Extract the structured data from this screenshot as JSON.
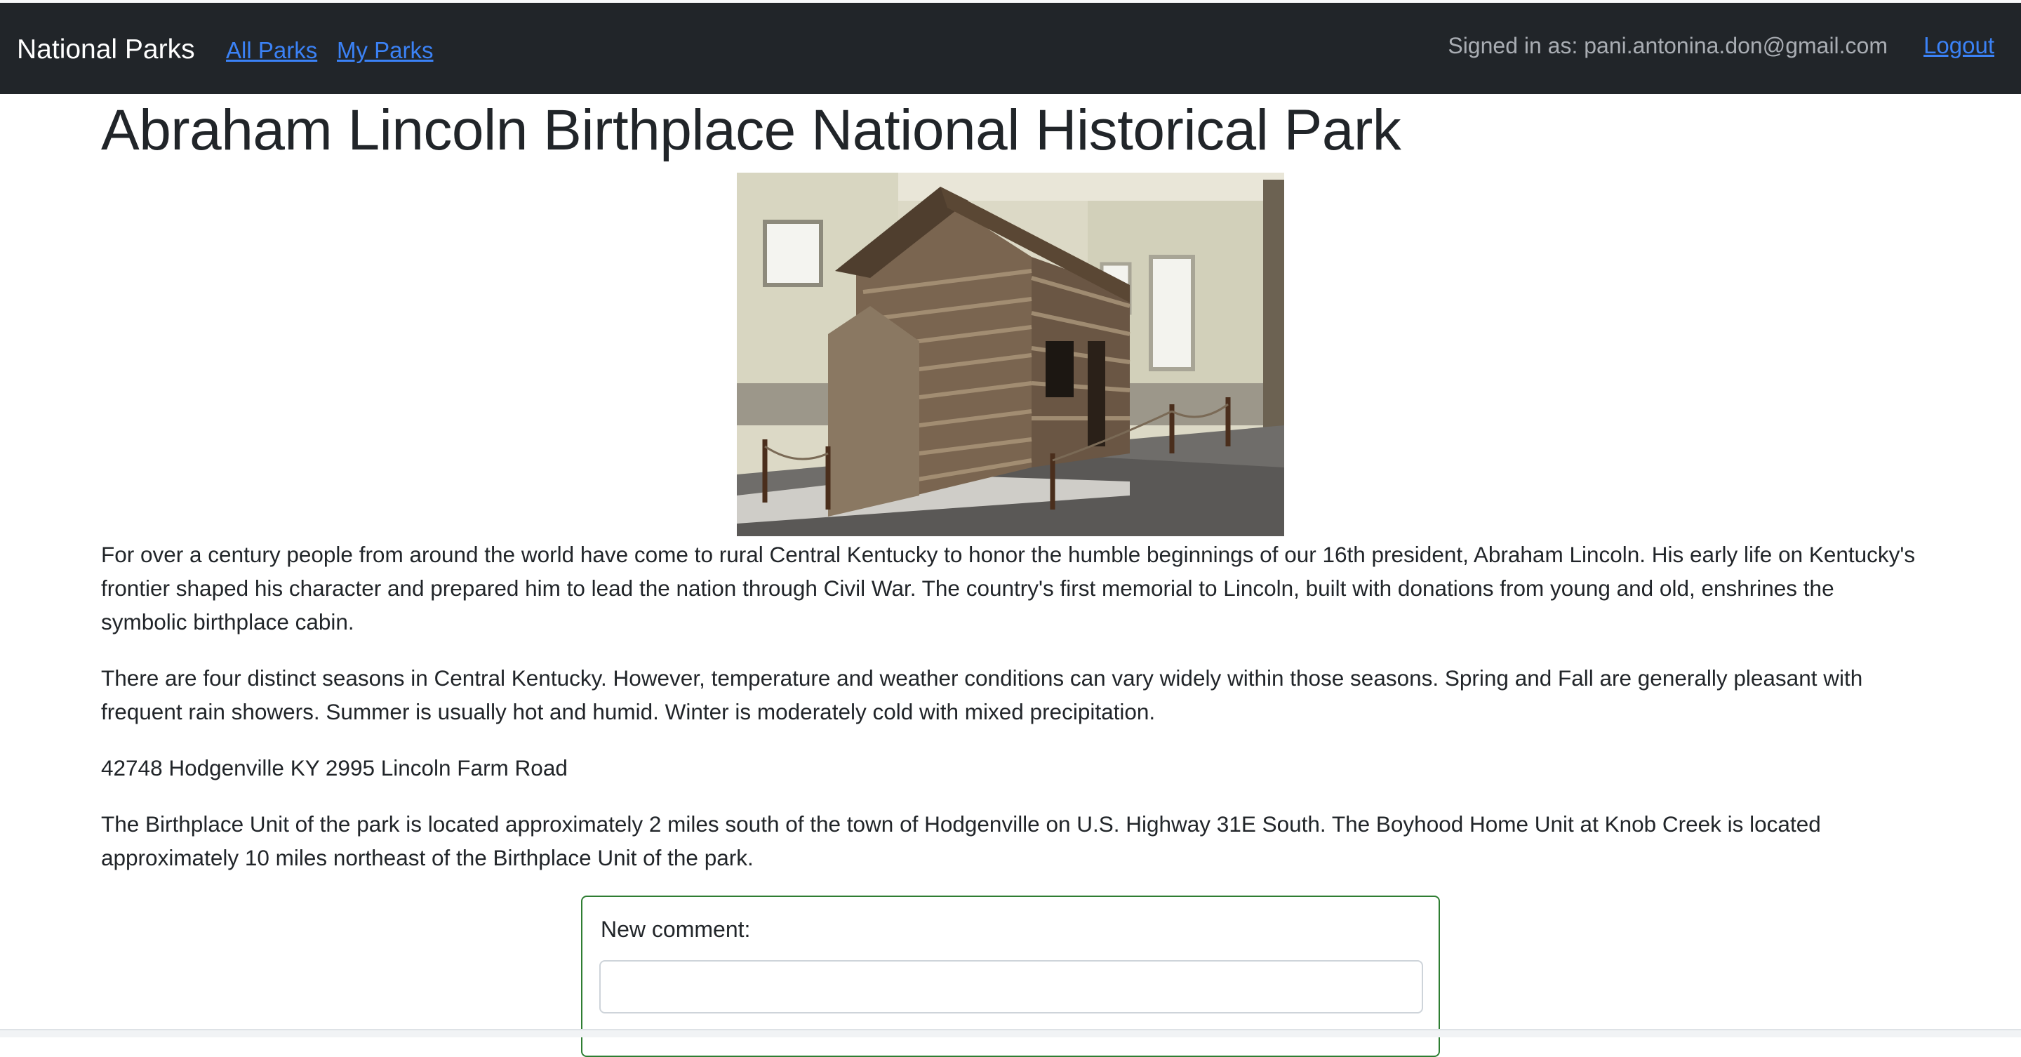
{
  "navbar": {
    "brand": "National Parks",
    "links": [
      "All Parks",
      "My Parks"
    ],
    "signed_in": "Signed in as: pani.antonina.don@gmail.com",
    "logout": "Logout"
  },
  "park": {
    "title": "Abraham Lincoln Birthplace National Historical Park",
    "image_icon": "log-cabin-photo",
    "description": "For over a century people from around the world have come to rural Central Kentucky to honor the humble beginnings of our 16th president, Abraham Lincoln. His early life on Kentucky's frontier shaped his character and prepared him to lead the nation through Civil War. The country's first memorial to Lincoln, built with donations from young and old, enshrines the symbolic birthplace cabin.",
    "weather": "There are four distinct seasons in Central Kentucky. However, temperature and weather conditions can vary widely within those seasons. Spring and Fall are generally pleasant with frequent rain showers. Summer is usually hot and humid. Winter is moderately cold with mixed precipitation.",
    "address": "42748 Hodgenville KY 2995 Lincoln Farm Road",
    "directions": "The Birthplace Unit of the park is located approximately 2 miles south of the town of Hodgenville on U.S. Highway 31E South. The Boyhood Home Unit at Knob Creek is located approximately 10 miles northeast of the Birthplace Unit of the park."
  },
  "comment": {
    "label": "New comment:",
    "value": "",
    "placeholder": ""
  },
  "colors": {
    "navbar_bg": "#212529",
    "link": "#3b82f6",
    "comment_border": "#2e7d32"
  }
}
